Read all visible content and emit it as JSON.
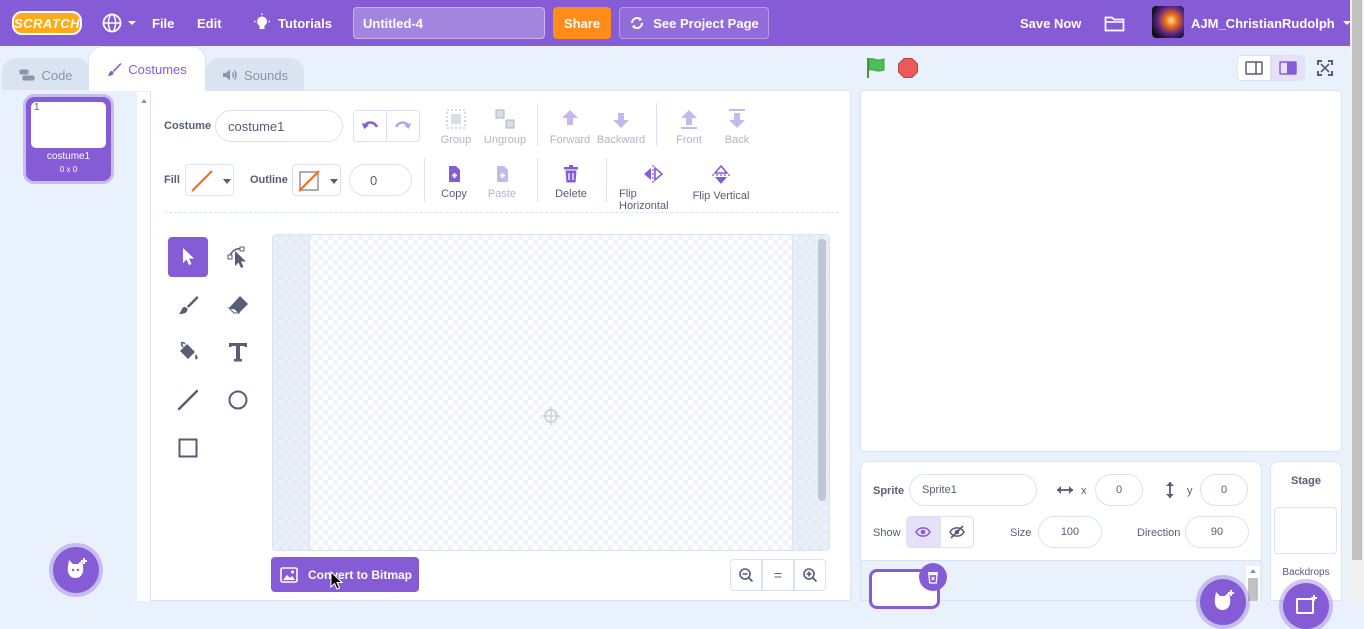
{
  "menubar": {
    "logo": "SCRATCH",
    "file": "File",
    "edit": "Edit",
    "tutorials": "Tutorials",
    "project_title": "Untitled-4",
    "share": "Share",
    "see_project_page": "See Project Page",
    "save_now": "Save Now",
    "username": "AJM_ChristianRudolph"
  },
  "tabs": {
    "code": "Code",
    "costumes": "Costumes",
    "sounds": "Sounds"
  },
  "costume_list": {
    "items": [
      {
        "index": "1",
        "name": "costume1",
        "size": "0 x 0"
      }
    ]
  },
  "editor": {
    "costume_label": "Costume",
    "costume_name": "costume1",
    "fill_label": "Fill",
    "outline_label": "Outline",
    "outline_width": "0",
    "group": "Group",
    "ungroup": "Ungroup",
    "forward": "Forward",
    "backward": "Backward",
    "front": "Front",
    "back": "Back",
    "copy": "Copy",
    "paste": "Paste",
    "delete": "Delete",
    "flip_horizontal": "Flip Horizontal",
    "flip_vertical": "Flip Vertical",
    "convert_button": "Convert to Bitmap",
    "zoom_reset": "="
  },
  "sprite_info": {
    "sprite_label": "Sprite",
    "sprite_name": "Sprite1",
    "x_label": "x",
    "x_value": "0",
    "y_label": "y",
    "y_value": "0",
    "show_label": "Show",
    "size_label": "Size",
    "size_value": "100",
    "direction_label": "Direction",
    "direction_value": "90"
  },
  "stage_pane": {
    "title": "Stage",
    "backdrops_label": "Backdrops"
  },
  "colors": {
    "accent": "#855cd6",
    "share": "#ff8c1a",
    "green_flag": "#4cbf56",
    "stop": "#ec5959",
    "background": "#e9f1fc"
  }
}
